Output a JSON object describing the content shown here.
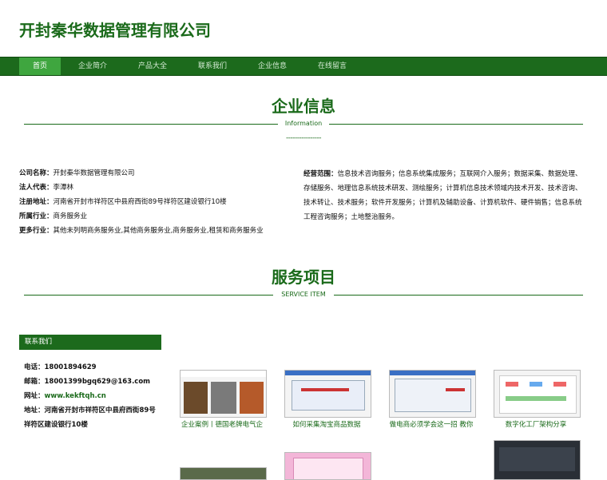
{
  "header": {
    "title": "开封秦华数据管理有限公司"
  },
  "nav": {
    "items": [
      "首页",
      "企业简介",
      "产品大全",
      "联系我们",
      "企业信息",
      "在线留言"
    ]
  },
  "company_section": {
    "title": "企业信息",
    "subtitle": "Information",
    "dashes": "----------------",
    "rows": [
      {
        "label": "公司名称：",
        "value": "开封秦华数据管理有限公司"
      },
      {
        "label": "法人代表：",
        "value": "李潭林"
      },
      {
        "label": "注册地址：",
        "value": "河南省开封市祥符区中县府西街89号祥符区建设银行10楼"
      },
      {
        "label": "所属行业：",
        "value": "商务服务业"
      },
      {
        "label": "更多行业：",
        "value": "其他未列明商务服务业,其他商务服务业,商务服务业,租赁和商务服务业"
      }
    ],
    "scope_label": "经营范围：",
    "scope_value": "信息技术咨询服务；信息系统集成服务；互联网介入服务；数据采集、数据处理、存储服务、地理信息系统技术研发、测绘服务；计算机信息技术领域内技术开发、技术咨询、技术转让、技术服务；软件开发服务；计算机及辅助设备、计算机软件、硬件销售；信息系统工程咨询服务；土地整治服务。"
  },
  "service_section": {
    "title": "服务项目",
    "subtitle": "SERVICE ITEM"
  },
  "contact": {
    "heading": "联系我们",
    "phone_label": "电话：",
    "phone": "18001894629",
    "email_label": "邮箱：",
    "email": "18001399bgq629@163.com",
    "site_label": "网址：",
    "site": "www.kekftqh.cn",
    "address_label": "地址：",
    "address_line1": "河南省开封市祥符区中县府西街89号",
    "address_line2": "祥符区建设银行10楼"
  },
  "cases": [
    {
      "caption": "企业案例丨德国老牌电气企"
    },
    {
      "caption": "如何采集淘宝商品数据"
    },
    {
      "caption": "做电商必须学会这一招 教你"
    },
    {
      "caption": "数字化工厂架构分享"
    }
  ]
}
